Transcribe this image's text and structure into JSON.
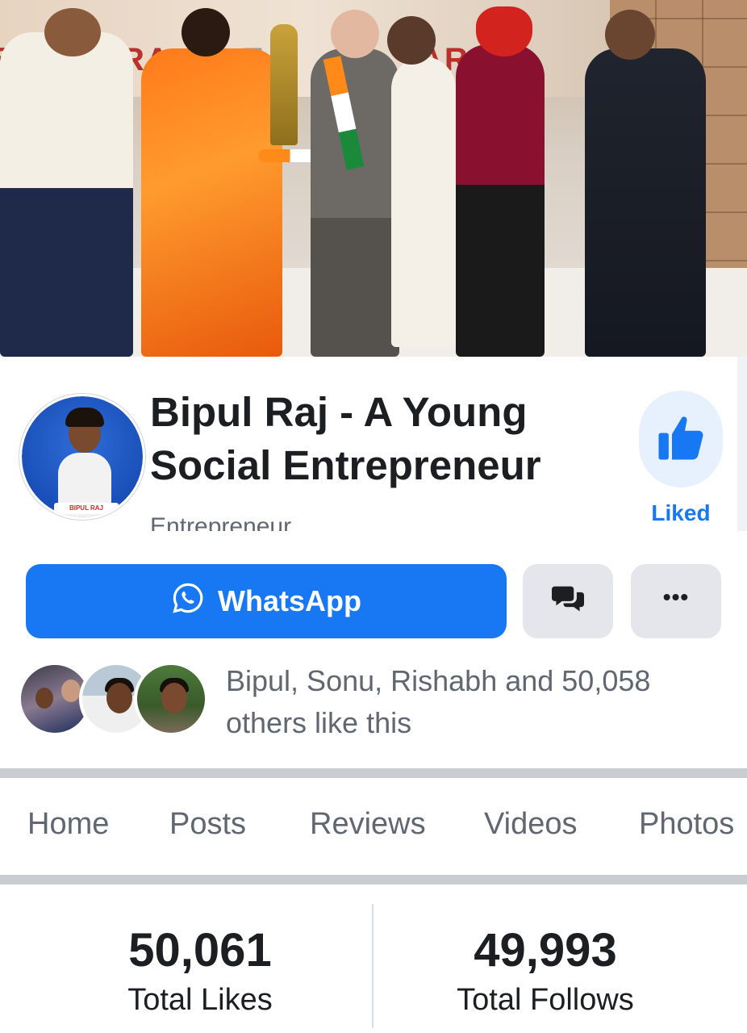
{
  "page": {
    "title": "Bipul Raj - A Young Social Entrepreneur",
    "category": "Entrepreneur",
    "like_status": "Liked",
    "avatar_tag": "BIPUL RAJ"
  },
  "actions": {
    "whatsapp_label": "WhatsApp",
    "message_icon": "messenger-chat-icon",
    "more_label": "•••"
  },
  "friends": {
    "text": "Bipul, Sonu, Rishabh and 50,058 others like this"
  },
  "tabs": [
    {
      "label": "Home"
    },
    {
      "label": "Posts"
    },
    {
      "label": "Reviews"
    },
    {
      "label": "Videos"
    },
    {
      "label": "Photos"
    }
  ],
  "stats": {
    "likes": {
      "value": "50,061",
      "label": "Total Likes"
    },
    "follows": {
      "value": "49,993",
      "label": "Total Follows"
    }
  },
  "colors": {
    "accent": "#1877f2",
    "button_grey": "#e4e6eb",
    "text_secondary": "#606770",
    "divider": "#c9ccd1"
  }
}
